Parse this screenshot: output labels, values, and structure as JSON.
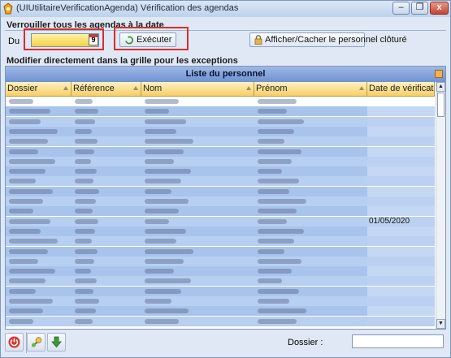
{
  "window": {
    "title": "(UIUtilitaireVerificationAgenda) Vérification des agendas",
    "minimize_glyph": "–",
    "restore_glyph": "❐",
    "close_glyph": "x"
  },
  "lock_section": {
    "title": "Verrouiller tous les agendas à la date",
    "du_label": "Du",
    "date_value": "",
    "calendar_day": "9",
    "execute_label": "Exécuter",
    "toggle_closed_label": "Afficher/Cacher le personnel clôturé"
  },
  "grid_section": {
    "title": "Modifier directement dans la grille pour les exceptions",
    "caption": "Liste du personnel",
    "columns": [
      "Dossier",
      "Référence",
      "Nom",
      "Prénom",
      "Date de vérification"
    ],
    "visible_date": "01/05/2020",
    "visible_date_row": 12
  },
  "bottom": {
    "dossier_label": "Dossier :",
    "dossier_value": ""
  },
  "colors": {
    "highlight": "#d92d2d",
    "row_blue": "#a9c4ec",
    "row_blue_alt": "#b7cff1",
    "header_gold": "#f6cf67",
    "caption_blue": "#6f91d2"
  },
  "icons": [
    "app-icon",
    "calendar-icon",
    "refresh-icon",
    "lock-icon",
    "power-icon",
    "tool-icon",
    "arrow-down-icon"
  ]
}
